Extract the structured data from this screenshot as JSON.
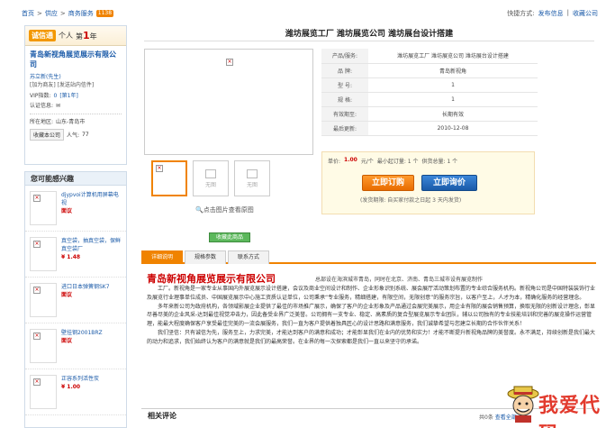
{
  "breadcrumb": {
    "home": "首页",
    "supply": "供应",
    "category": "商务服务",
    "hot": "1138"
  },
  "quick_links": {
    "label": "快捷方式:",
    "publish": "发布信息",
    "sep": "|",
    "favorite": "收藏公司"
  },
  "company": {
    "badge": "诚信通",
    "tag": "个人",
    "year_prefix": "第",
    "year_num": "1",
    "year_suffix": "年",
    "name": "青岛新视角展览展示有限公司",
    "contact": "苏立新(先生)",
    "contact_actions": "[加为商友] [发送站内信件]",
    "vip_label": "VIP指数:",
    "vip_value": "0",
    "vip_level": "[第1年]",
    "cert_label": "认证信息:",
    "region_label": "所在地区:",
    "region_value": "山东-青岛市",
    "collect_btn": "收藏本公司",
    "popularity_label": "人气:",
    "popularity_value": "77"
  },
  "related": {
    "title": "您可能感兴趣",
    "items": [
      {
        "title": "djypvoi计算机用屏幕电视",
        "price": "面议"
      },
      {
        "title": "真空袋，抽真空袋，保鲜真空袋厂",
        "price": "¥ 1.48"
      },
      {
        "title": "进口日本弹簧钢SK7",
        "price": "面议"
      },
      {
        "title": "壁挂钢2001BRZ",
        "price": "面议"
      },
      {
        "title": "正容系列活性炭",
        "price": "¥ 1.00"
      }
    ]
  },
  "product": {
    "title": "潍坊展览工厂 潍坊展览公司 潍坊展台设计搭建",
    "image_placeholder": "无图",
    "enlarge": "点击图片查看原图",
    "specs": [
      {
        "k": "产品/服务:",
        "v": "潍坊展览工厂 潍坊展览公司 潍坊展台设计搭建"
      },
      {
        "k": "品 牌:",
        "v": "青岛新视角"
      },
      {
        "k": "型 号:",
        "v": "1"
      },
      {
        "k": "规 格:",
        "v": "1"
      },
      {
        "k": "有效期至:",
        "v": "长期有效"
      },
      {
        "k": "最后更新:",
        "v": "2010-12-08"
      }
    ],
    "unit_price_label": "单价:",
    "unit_price": "1.00",
    "unit": "元/个",
    "min_order": "最小起订量: 1 个",
    "supply_total": "供货总量: 1 个",
    "order_btn": "立即订购",
    "inquiry_btn": "立即询价",
    "delivery_note": "(发货期限: 自买家付款之日起  3 天内发货)",
    "collect_btn": "收藏此商品"
  },
  "tabs": [
    "详细说明",
    "规格参数",
    "联系方式"
  ],
  "description": {
    "company_title": "青岛新视角展览展示有限公司",
    "company_sub": "总部设在海滨城市青岛，同时在北京、济南、青岛三城市设有展览制作",
    "paragraphs": [
      "工厂。新视角是一家专业从事国内外展览展示设计搭建，会议及商业空间设计和制作、企业形象识别系统、展会展厅活动策划布置的专业综合服务机构。新视角公司是中国特装装饰行业及展览行业理事单位成员、中国展览展示中心施工资质认证单位，公司秉承“专业服务，精细搭建，有限空间，无限创意”的服务宗旨，以客户至上，人才为本，精确化服务的经营理念。",
      "多年来新公司为政府机构，各领域影展企业提供了最佳的市场推广展示，确保了客户的企业形象及产品通过会展完美展示，用企业有限的展会销售预算，换取无限的创新设计理念，彰显尽善尽美的企业风采-达到最佳视觉冲击力，因此备受业界广泛美誉。公司拥有一支专业、稳定、高素质的复合型展览展示专业团队，辅以公司独有的专业技能培训和完善的展览操作运营管理，能最大程度确保客户享受最佳完美的一流会展服务，我们一直为客户提供着独具匠心的设计思路和满意服务，我们诚挚希望与您建立长期的合作伙伴关系！",
      "我们坚信：只有诚信为先，服务至上，力求完美，才能达到客户的满意和成功；才能彰显我们在业内的优势和实力！才能不断提升新视角品牌的美誉度。永不满足，持续创新是我们最大的动力和追求，我们始终认为客户的满意就是我们的最高荣誉。在业界的每一次探索都是我们一直以来坚守的承诺。"
    ]
  },
  "comments": {
    "title": "相关评论",
    "count_label": "共0条",
    "more": "查看全部"
  },
  "watermark": {
    "text": "我爱代码"
  }
}
